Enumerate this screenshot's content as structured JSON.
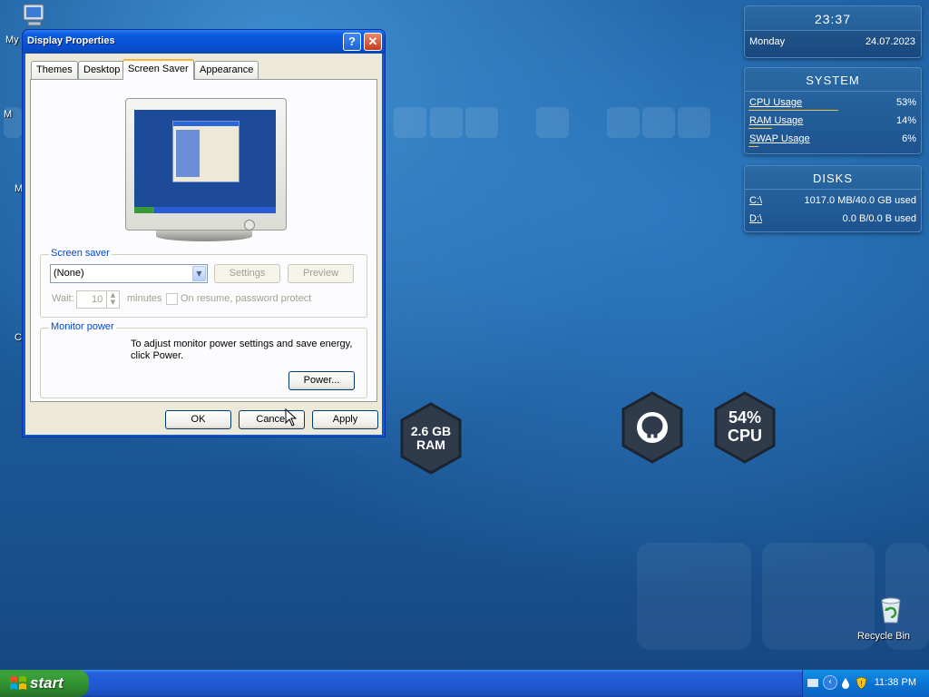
{
  "desktop": {
    "icons": [
      {
        "label": "My",
        "icon": "my-computer-icon"
      },
      {
        "label": "Recycle Bin",
        "icon": "recycle-bin-icon"
      }
    ],
    "partial_labels": [
      "M",
      "M",
      "C"
    ]
  },
  "widgets": {
    "clock": {
      "time": "23:37",
      "day": "Monday",
      "date": "24.07.2023"
    },
    "system": {
      "title": "SYSTEM",
      "rows": [
        {
          "label": "CPU Usage",
          "value": "53%",
          "level": 0.53
        },
        {
          "label": "RAM Usage",
          "value": "14%",
          "level": 0.14
        },
        {
          "label": "SWAP Usage",
          "value": "6%",
          "level": 0.06
        }
      ]
    },
    "disks": {
      "title": "DISKS",
      "rows": [
        {
          "label": "C:\\",
          "value": "1017.0 MB/40.0 GB used"
        },
        {
          "label": "D:\\",
          "value": "0.0 B/0.0 B used"
        }
      ]
    },
    "hex_ram": {
      "line1": "2.6 GB",
      "line2": "RAM"
    },
    "hex_github": {
      "icon": "github-icon"
    },
    "hex_cpu": {
      "line1": "54%",
      "line2": "CPU"
    }
  },
  "dialog": {
    "title": "Display Properties",
    "help_glyph": "?",
    "close_glyph": "✕",
    "tabs": [
      "Themes",
      "Desktop",
      "Screen Saver",
      "Appearance"
    ],
    "active_tab": "Screen Saver",
    "screen_saver": {
      "group_label": "Screen saver",
      "selected": "(None)",
      "settings_label": "Settings",
      "preview_label": "Preview",
      "wait_label": "Wait:",
      "wait_value": "10",
      "minutes_label": "minutes",
      "resume_label": "On resume, password protect"
    },
    "monitor_power": {
      "group_label": "Monitor power",
      "description_line1": "To adjust monitor power settings and save energy,",
      "description_line2": "click Power.",
      "power_button": "Power..."
    },
    "buttons": {
      "ok": "OK",
      "cancel": "Cancel",
      "apply": "Apply"
    }
  },
  "taskbar": {
    "start_label": "start",
    "clock": "11:38 PM",
    "tray_icons": [
      "keyboard-icon",
      "chevron-left-icon",
      "water-drop-icon",
      "security-shield-icon"
    ]
  }
}
